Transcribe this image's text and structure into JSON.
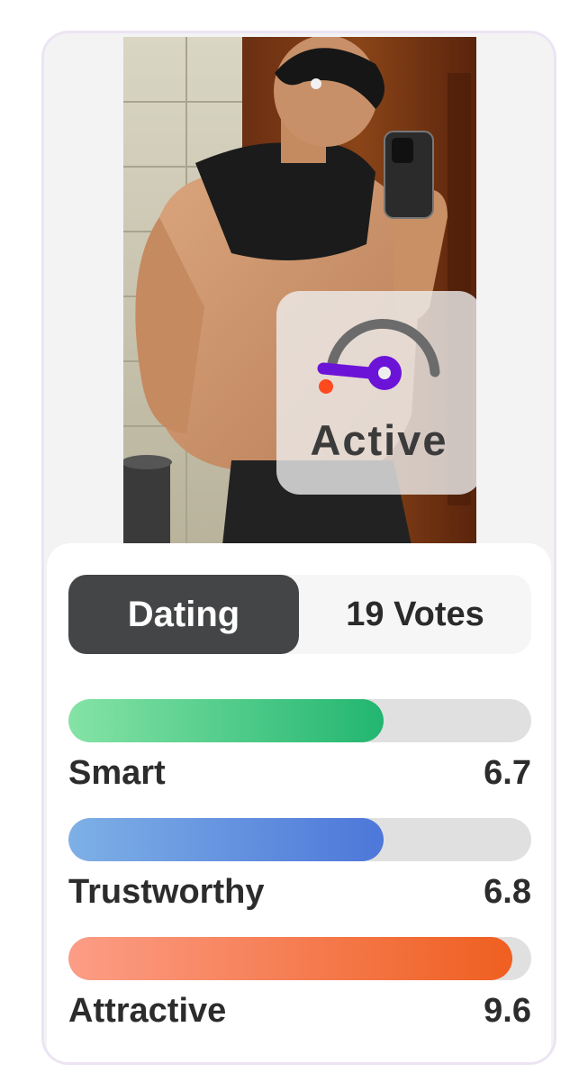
{
  "status": {
    "label": "Active",
    "icon": "speedometer-icon"
  },
  "tabs": {
    "active_label": "Dating",
    "votes_label": "19 Votes"
  },
  "metrics": [
    {
      "label": "Smart",
      "value": "6.7",
      "fill_fraction": 0.68,
      "color_start": "#85e3a6",
      "color_end": "#22b670"
    },
    {
      "label": "Trustworthy",
      "value": "6.8",
      "fill_fraction": 0.68,
      "color_start": "#7eb0e6",
      "color_end": "#4d77d9"
    },
    {
      "label": "Attractive",
      "value": "9.6",
      "fill_fraction": 0.96,
      "color_start": "#fc9d86",
      "color_end": "#ef5f20"
    }
  ],
  "colors": {
    "gauge_arc": "#6b6b6b",
    "gauge_needle": "#6c13d8",
    "gauge_dot": "#ff4a20",
    "tab_active_bg": "#444546"
  }
}
